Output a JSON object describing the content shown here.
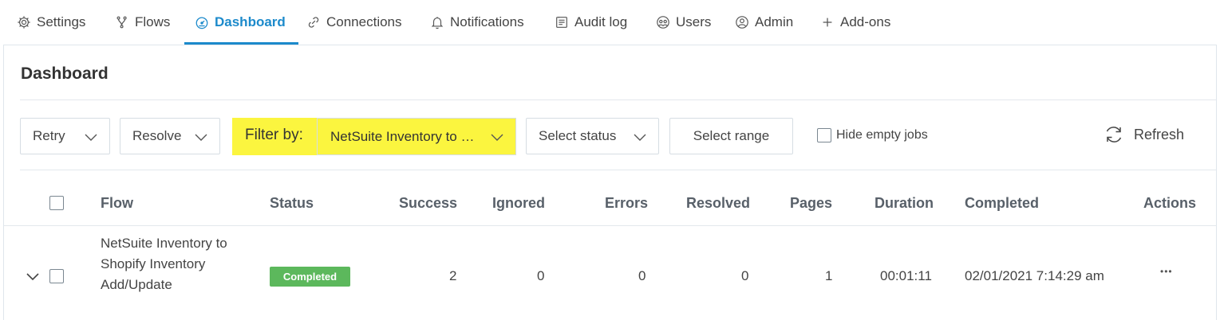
{
  "nav": {
    "tabs": [
      {
        "label": "Settings",
        "icon": "gear-icon"
      },
      {
        "label": "Flows",
        "icon": "flow-icon"
      },
      {
        "label": "Dashboard",
        "icon": "dashboard-icon",
        "active": true
      },
      {
        "label": "Connections",
        "icon": "link-icon"
      },
      {
        "label": "Notifications",
        "icon": "bell-icon"
      },
      {
        "label": "Audit log",
        "icon": "audit-log-icon"
      },
      {
        "label": "Users",
        "icon": "users-icon"
      },
      {
        "label": "Admin",
        "icon": "admin-icon"
      },
      {
        "label": "Add-ons",
        "icon": "plus-icon"
      }
    ]
  },
  "page": {
    "title": "Dashboard"
  },
  "toolbar": {
    "retry_label": "Retry",
    "resolve_label": "Resolve",
    "filter_label": "Filter by:",
    "filter_value": "NetSuite Inventory to …",
    "status_label": "Select status",
    "range_label": "Select range",
    "hide_empty_label": "Hide empty jobs",
    "refresh_label": "Refresh"
  },
  "table": {
    "columns": [
      "Flow",
      "Status",
      "Success",
      "Ignored",
      "Errors",
      "Resolved",
      "Pages",
      "Duration",
      "Completed",
      "Actions"
    ],
    "rows": [
      {
        "flow_line1": "NetSuite Inventory to",
        "flow_line2": "Shopify Inventory",
        "flow_line3": "Add/Update",
        "status": "Completed",
        "success": "2",
        "ignored": "0",
        "errors": "0",
        "resolved": "0",
        "pages": "1",
        "duration": "00:01:11",
        "completed": "02/01/2021 7:14:29 am",
        "actions": "•••"
      }
    ]
  },
  "colors": {
    "accent": "#1c8acb",
    "highlight": "#fbf53f",
    "success": "#5cb85c"
  }
}
